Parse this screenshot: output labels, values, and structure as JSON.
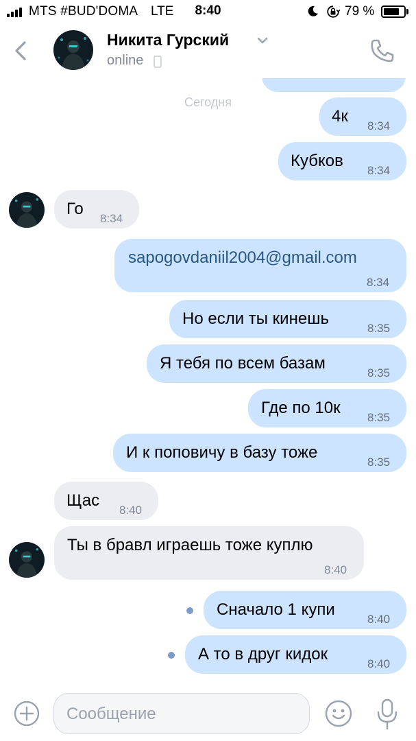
{
  "status_bar": {
    "carrier": "MTS #BUD'DOMA",
    "network": "LTE",
    "time": "8:40",
    "battery_percent": "79 %",
    "battery_level": 0.79,
    "icons": [
      "signal-icon",
      "moon-icon",
      "rotation-lock-icon",
      "battery-icon"
    ]
  },
  "header": {
    "name": "Никита Гурский",
    "status": "online",
    "icons": [
      "back-icon",
      "chevron-down-icon",
      "mobile-phone-icon",
      "call-icon"
    ]
  },
  "chat": {
    "date_separator": "Сегодня",
    "messages": [
      {
        "dir": "out",
        "text": "4к",
        "time": "8:34"
      },
      {
        "dir": "out",
        "text": "Кубков",
        "time": "8:34"
      },
      {
        "dir": "in",
        "text": "Го",
        "time": "8:34",
        "avatar": true
      },
      {
        "dir": "out",
        "text": "sapogovdaniil2004@gmail.com",
        "time": "8:34",
        "is_link": true
      },
      {
        "dir": "out",
        "text": "Но если ты кинешь",
        "time": "8:35"
      },
      {
        "dir": "out",
        "text": "Я тебя по всем базам",
        "time": "8:35"
      },
      {
        "dir": "out",
        "text": "Где по 10к",
        "time": "8:35"
      },
      {
        "dir": "out",
        "text": "И к поповичу в базу тоже",
        "time": "8:35"
      },
      {
        "dir": "in",
        "text": "Щас",
        "time": "8:40"
      },
      {
        "dir": "in",
        "text": "Ты в бравл играешь тоже куплю",
        "time": "8:40",
        "avatar": true
      },
      {
        "dir": "out",
        "text": "Сначало 1 купи",
        "time": "8:40",
        "unread": true
      },
      {
        "dir": "out",
        "text": "А то в друг кидок",
        "time": "8:40",
        "unread": true
      }
    ]
  },
  "input_bar": {
    "placeholder": "Сообщение",
    "value": "",
    "icons": [
      "plus-icon",
      "emoji-icon",
      "microphone-icon"
    ]
  },
  "colors": {
    "outgoing_bubble": "#cce4ff",
    "incoming_bubble": "#ebedf0",
    "link": "#2a5885",
    "accent_icons": "#99a2ad",
    "unread_dot": "#7d9cc7"
  }
}
